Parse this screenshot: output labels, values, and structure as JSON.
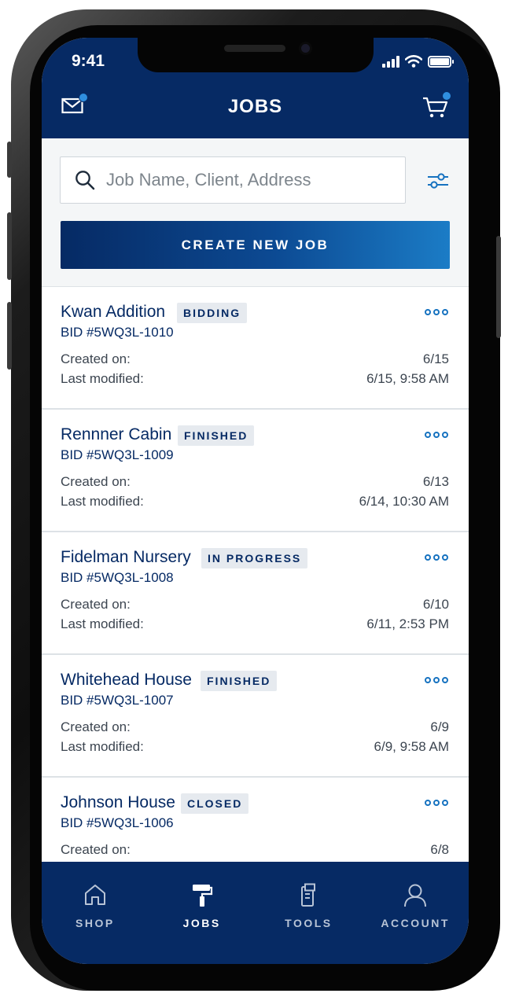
{
  "status_bar": {
    "time": "9:41"
  },
  "header": {
    "title": "JOBS",
    "mail_icon": "mail-icon",
    "cart_icon": "cart-icon",
    "accent": "#2f8fe0"
  },
  "search": {
    "placeholder": "Job Name, Client, Address",
    "value": ""
  },
  "create_button": {
    "label": "CREATE NEW JOB"
  },
  "labels": {
    "created": "Created on:",
    "modified": "Last modified:"
  },
  "jobs": [
    {
      "name": "Kwan Addition",
      "status": "BIDDING",
      "bid": "BID #5WQ3L-1010",
      "created": "6/15",
      "modified": "6/15, 9:58 AM"
    },
    {
      "name": "Rennner Cabin",
      "status": "FINISHED",
      "bid": "BID #5WQ3L-1009",
      "created": "6/13",
      "modified": "6/14, 10:30 AM"
    },
    {
      "name": "Fidelman Nursery",
      "status": "IN PROGRESS",
      "bid": "BID #5WQ3L-1008",
      "created": "6/10",
      "modified": "6/11, 2:53 PM"
    },
    {
      "name": "Whitehead House",
      "status": "FINISHED",
      "bid": "BID #5WQ3L-1007",
      "created": "6/9",
      "modified": "6/9, 9:58 AM"
    },
    {
      "name": "Johnson House",
      "status": "CLOSED",
      "bid": "BID #5WQ3L-1006",
      "created": "6/8",
      "modified": ""
    }
  ],
  "tabs": [
    {
      "label": "SHOP",
      "icon": "home-icon"
    },
    {
      "label": "JOBS",
      "icon": "paint-roller-icon",
      "active": true
    },
    {
      "label": "TOOLS",
      "icon": "tools-icon"
    },
    {
      "label": "ACCOUNT",
      "icon": "user-icon"
    }
  ],
  "colors": {
    "brand_navy": "#062a64",
    "link_blue": "#1672c0",
    "badge_bg": "#e6eaef"
  }
}
